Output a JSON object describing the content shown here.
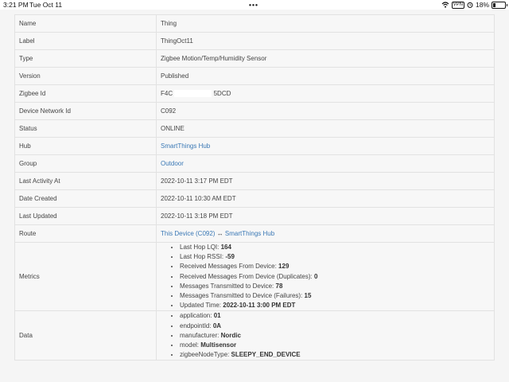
{
  "statusbar": {
    "time": "3:21 PM",
    "date": "Tue Oct 11",
    "vpn": "VPN",
    "battery": "18%",
    "battery_level": 0.18
  },
  "props": {
    "name": {
      "label": "Name",
      "value": "Thing"
    },
    "label": {
      "label": "Label",
      "value": "ThingOct11"
    },
    "type": {
      "label": "Type",
      "value": "Zigbee Motion/Temp/Humidity Sensor"
    },
    "version": {
      "label": "Version",
      "value": "Published"
    },
    "zigbee": {
      "label": "Zigbee Id",
      "prefix": "F4C",
      "suffix": "5DCD"
    },
    "dni": {
      "label": "Device Network Id",
      "value": "C092"
    },
    "status": {
      "label": "Status",
      "value": "ONLINE"
    },
    "hub": {
      "label": "Hub",
      "value": "SmartThings Hub"
    },
    "group": {
      "label": "Group",
      "value": "Outdoor"
    },
    "activity": {
      "label": "Last Activity At",
      "value": "2022-10-11 3:17 PM EDT"
    },
    "created": {
      "label": "Date Created",
      "value": "2022-10-11 10:30 AM EDT"
    },
    "updated": {
      "label": "Last Updated",
      "value": "2022-10-11 3:18 PM EDT"
    },
    "route": {
      "label": "Route",
      "from": "This Device (C092)",
      "arrow": " ↔ ",
      "to": "SmartThings Hub"
    },
    "metrics": {
      "label": "Metrics",
      "items": [
        {
          "k": "Last Hop LQI: ",
          "v": "164"
        },
        {
          "k": "Last Hop RSSI: ",
          "v": "-59"
        },
        {
          "k": "Received Messages From Device: ",
          "v": "129"
        },
        {
          "k": "Received Messages From Device (Duplicates): ",
          "v": "0"
        },
        {
          "k": "Messages Transmitted to Device: ",
          "v": "78"
        },
        {
          "k": "Messages Transmitted to Device (Failures): ",
          "v": "15"
        },
        {
          "k": "Updated Time: ",
          "v": "2022-10-11 3:00 PM EDT"
        }
      ]
    },
    "data": {
      "label": "Data",
      "items": [
        {
          "k": "application: ",
          "v": "01"
        },
        {
          "k": "endpointId: ",
          "v": "0A"
        },
        {
          "k": "manufacturer: ",
          "v": "Nordic"
        },
        {
          "k": "model: ",
          "v": "Multisensor"
        },
        {
          "k": "zigbeeNodeType: ",
          "v": "SLEEPY_END_DEVICE"
        }
      ]
    }
  }
}
